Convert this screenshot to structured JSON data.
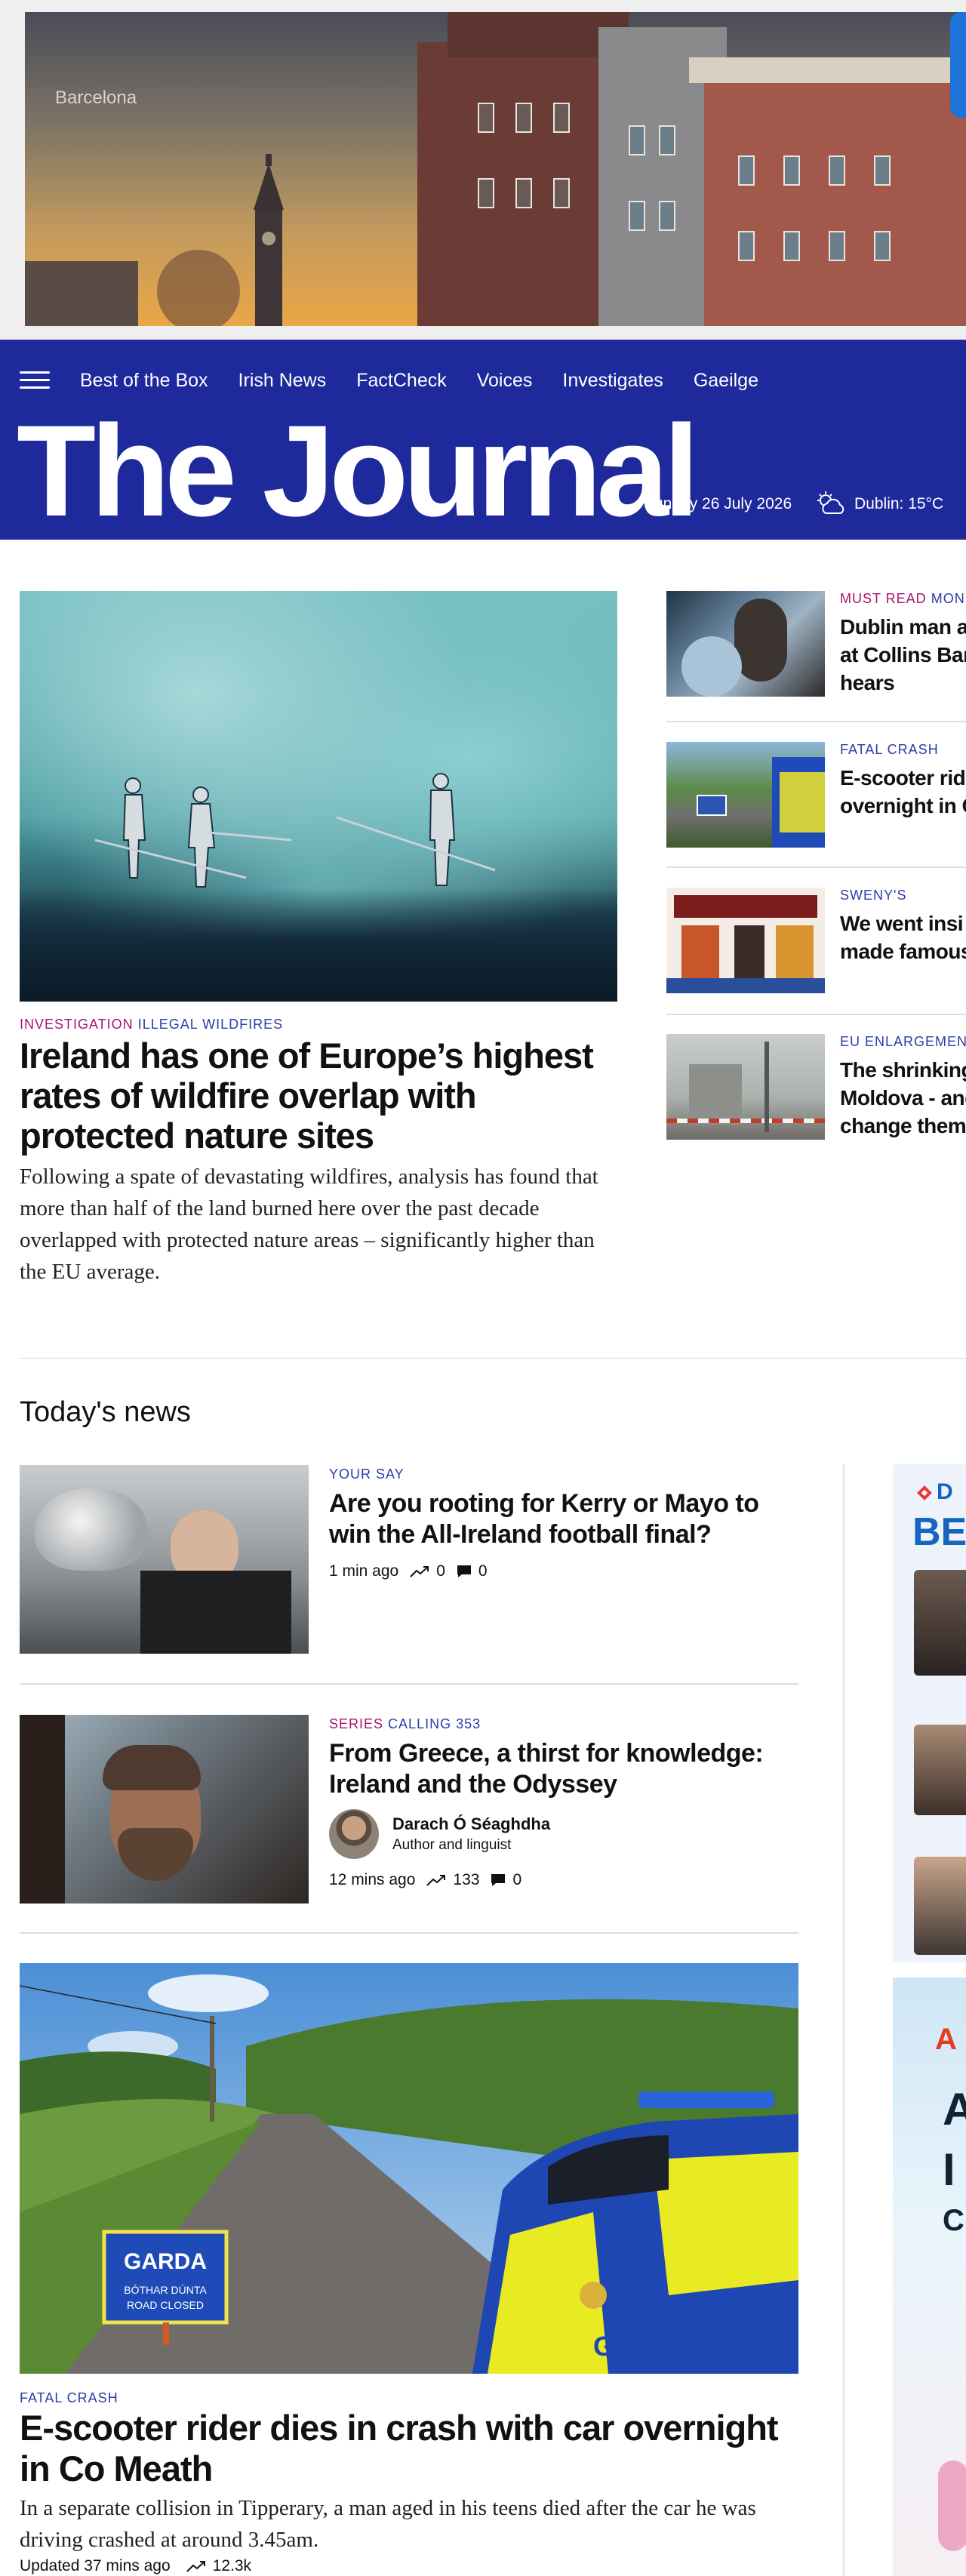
{
  "ad_banner": {
    "caption": "Barcelona"
  },
  "nav": {
    "items": [
      "Best of the Box",
      "Irish News",
      "FactCheck",
      "Voices",
      "Investigates",
      "Gaeilge"
    ]
  },
  "masthead": {
    "logo": "The Journal",
    "date": "Sunday 26 July 2026",
    "weather": "Dublin: 15°C"
  },
  "lead": {
    "kicker_primary": "INVESTIGATION",
    "kicker_secondary": "ILLEGAL WILDFIRES",
    "title": "Ireland has one of Europe’s highest rates of wildfire overlap with protected nature sites",
    "summary": "Following a spate of devastating wildfires, analysis has found that more than half of the land burned here over the past decade overlapped with protected nature areas – significantly higher than the EU average."
  },
  "sidebar_stories": [
    {
      "kicker_primary": "MUST READ",
      "kicker_secondary": "MON",
      "title_lines": [
        "Dublin man a",
        "at Collins Bar",
        "hears"
      ]
    },
    {
      "kicker_primary": "",
      "kicker_secondary": "FATAL CRASH",
      "title_lines": [
        "E-scooter ride",
        "overnight in C"
      ]
    },
    {
      "kicker_primary": "",
      "kicker_secondary": "SWENY'S",
      "title_lines": [
        "We went insi",
        "made famous"
      ]
    },
    {
      "kicker_primary": "",
      "kicker_secondary": "EU ENLARGEMEN",
      "title_lines": [
        "The shrinking",
        "Moldova - and",
        "change them"
      ]
    }
  ],
  "todays_news": {
    "heading": "Today's news",
    "items": [
      {
        "kicker_primary": "",
        "kicker_secondary": "YOUR SAY",
        "title": "Are you rooting for Kerry or Mayo to win the All-Ireland football final?",
        "time": "1 min ago",
        "views": "0",
        "comments": "0"
      },
      {
        "kicker_primary": "SERIES",
        "kicker_secondary": "CALLING 353",
        "title": "From Greece, a thirst for knowledge: Ireland and the Odyssey",
        "author_name": "Darach Ó Séaghdha",
        "author_role": "Author and linguist",
        "time": "12 mins ago",
        "views": "133",
        "comments": "0"
      }
    ],
    "feature": {
      "kicker": "FATAL CRASH",
      "title": "E-scooter rider dies in crash with car overnight in Co Meath",
      "summary": "In a separate collision in Tipperary, a man aged in his teens died after the car he was driving crashed at around 3.45am.",
      "time": "Updated 37 mins ago",
      "views": "12.3k",
      "sign_text_1": "GARDA",
      "sign_text_2": "BÓTHAR DÚNTA",
      "sign_text_3": "ROAD CLOSED",
      "car_text": "GARDA"
    }
  },
  "partner": {
    "brand_short": "D",
    "brand_word": "BES"
  },
  "ad_right": {
    "line1": "A",
    "line2": "A",
    "line3": "I",
    "line4": "C"
  },
  "colors": {
    "masthead_bg": "#1e2a9c",
    "kicker_pink": "#a8146e",
    "kicker_blue": "#2b3da8"
  }
}
